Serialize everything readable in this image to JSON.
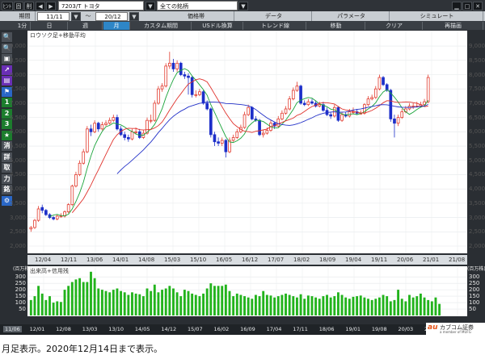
{
  "toolbar": {
    "hint_label": "ﾋﾝﾄ",
    "pin_label": "固",
    "delete_label": "削",
    "symbol_value": "7203/T トヨタ",
    "filter_value": "全ての銘柄",
    "period_label": "期間",
    "period_from": "11/11",
    "period_to": "20/12",
    "main_tabs": [
      "価格帯",
      "データ",
      "パラメータ",
      "シミュレート"
    ],
    "range_tabs": [
      "1分",
      "日",
      "週",
      "月"
    ],
    "mode_buttons": [
      "カスタム期間",
      "USドル換算",
      "トレンド線",
      "移動",
      "クリア",
      "再描画"
    ]
  },
  "sidebar": {
    "items": [
      {
        "icon": "zoom-in-icon"
      },
      {
        "icon": "zoom-out-icon"
      },
      {
        "icon": "camera-icon"
      },
      {
        "icon": "chart-line-icon"
      },
      {
        "icon": "chart-bar-icon"
      },
      {
        "icon": "flag-icon"
      },
      {
        "label": "1"
      },
      {
        "label": "2"
      },
      {
        "label": "3"
      },
      {
        "icon": "star-icon"
      },
      {
        "label": "消"
      },
      {
        "label": "詳"
      },
      {
        "label": "取"
      },
      {
        "label": "力"
      },
      {
        "label": "銘"
      },
      {
        "icon": "gear-icon"
      }
    ]
  },
  "price_panel": {
    "label": "ロウソク足+移動平均",
    "ticks": [
      "9,000",
      "8,500",
      "8,000",
      "7,500",
      "7,000",
      "6,500",
      "6,000",
      "5,500",
      "5,000",
      "4,500",
      "4,000",
      "3,500",
      "3,000",
      "2,500",
      "2,000"
    ]
  },
  "volume_panel": {
    "label": "出来高+信用残",
    "unit_top": "(百万株)",
    "unit_bottom": "(百万株)",
    "ticks": [
      "300",
      "250",
      "200",
      "150",
      "100",
      "50"
    ]
  },
  "x_axis": {
    "labels": [
      "12/04",
      "12/11",
      "13/06",
      "14/01",
      "14/08",
      "15/03",
      "15/10",
      "16/05",
      "16/12",
      "17/07",
      "18/02",
      "18/09",
      "19/04",
      "19/11",
      "20/06",
      "21/01",
      "21/08"
    ],
    "bottom_labels": [
      "11/06",
      "12/01",
      "12/08",
      "13/03",
      "13/10",
      "14/05",
      "14/12",
      "15/07",
      "16/02",
      "16/09",
      "17/04",
      "17/11",
      "18/06",
      "19/01",
      "19/08",
      "20/03",
      "20/10"
    ]
  },
  "brand": {
    "logo": "au",
    "name": "カブコム証券",
    "subtitle": "a member of MUFG"
  },
  "caption": "月足表示。2020年12月14日まで表示。",
  "colors": {
    "up_candle": "#e23b2e",
    "down_candle": "#1d2fc9",
    "ma_short": "#1aa43a",
    "ma_mid": "#e0322c",
    "ma_long": "#2230c8",
    "volume_bar": "#22b31c",
    "active_tab": "#2e86c7"
  },
  "chart_data": {
    "type": "candlestick",
    "title": "ロウソク足+移動平均",
    "xlabel": "",
    "ylabel": "",
    "ylim": [
      2000,
      9200
    ],
    "volume_ylim": [
      0,
      320
    ],
    "x": [
      "12/02",
      "12/03",
      "12/04",
      "12/05",
      "12/06",
      "12/07",
      "12/08",
      "12/09",
      "12/10",
      "12/11",
      "12/12",
      "13/01",
      "13/02",
      "13/03",
      "13/04",
      "13/05",
      "13/06",
      "13/07",
      "13/08",
      "13/09",
      "13/10",
      "13/11",
      "13/12",
      "14/01",
      "14/02",
      "14/03",
      "14/04",
      "14/05",
      "14/06",
      "14/07",
      "14/08",
      "14/09",
      "14/10",
      "14/11",
      "14/12",
      "15/01",
      "15/02",
      "15/03",
      "15/04",
      "15/05",
      "15/06",
      "15/07",
      "15/08",
      "15/09",
      "15/10",
      "15/11",
      "15/12",
      "16/01",
      "16/02",
      "16/03",
      "16/04",
      "16/05",
      "16/06",
      "16/07",
      "16/08",
      "16/09",
      "16/10",
      "16/11",
      "16/12",
      "17/01",
      "17/02",
      "17/03",
      "17/04",
      "17/05",
      "17/06",
      "17/07",
      "17/08",
      "17/09",
      "17/10",
      "17/11",
      "17/12",
      "18/01",
      "18/02",
      "18/03",
      "18/04",
      "18/05",
      "18/06",
      "18/07",
      "18/08",
      "18/09",
      "18/10",
      "18/11",
      "18/12",
      "19/01",
      "19/02",
      "19/03",
      "19/04",
      "19/05",
      "19/06",
      "19/07",
      "19/08",
      "19/09",
      "19/10",
      "19/11",
      "19/12",
      "20/01",
      "20/02",
      "20/03",
      "20/04",
      "20/05",
      "20/06",
      "20/07",
      "20/08",
      "20/09",
      "20/10",
      "20/11",
      "20/12"
    ],
    "open": [
      2600,
      2650,
      2900,
      3350,
      3250,
      3100,
      3000,
      2950,
      3050,
      3050,
      3200,
      3450,
      4100,
      4500,
      4900,
      5300,
      6100,
      6000,
      6300,
      6100,
      6250,
      6300,
      6400,
      6500,
      6100,
      5900,
      5800,
      5750,
      6000,
      6000,
      5800,
      5950,
      6400,
      6400,
      7000,
      7500,
      7600,
      8300,
      8400,
      8200,
      8400,
      8000,
      7950,
      7900,
      7300,
      7300,
      7400,
      7000,
      6800,
      5900,
      5650,
      5600,
      5700,
      5300,
      5700,
      5800,
      6000,
      6150,
      6600,
      6850,
      6450,
      6400,
      5900,
      5950,
      6050,
      6300,
      6200,
      6450,
      6650,
      6800,
      7150,
      7450,
      7600,
      7000,
      6950,
      7050,
      7000,
      6900,
      6950,
      6750,
      6600,
      6550,
      6850,
      6400,
      6600,
      6550,
      6700,
      6700,
      6650,
      6650,
      6950,
      7150,
      7200,
      7500,
      7900,
      7650,
      7450,
      6450,
      6300,
      6500,
      6700,
      6800,
      6900,
      6900,
      6900,
      6950,
      7050
    ],
    "close": [
      2650,
      2900,
      3300,
      3250,
      3100,
      3000,
      2950,
      3050,
      3050,
      3200,
      3450,
      4100,
      4500,
      4900,
      5300,
      6100,
      6000,
      6300,
      6100,
      6250,
      6300,
      6400,
      6500,
      6100,
      5900,
      5800,
      5750,
      6000,
      6000,
      5800,
      5950,
      6400,
      6400,
      7000,
      7500,
      7600,
      8300,
      8400,
      8200,
      8400,
      8000,
      7950,
      7900,
      7300,
      7300,
      7400,
      7000,
      6800,
      5900,
      5650,
      5600,
      5700,
      5300,
      5700,
      5800,
      6000,
      6150,
      6600,
      6850,
      6450,
      6400,
      5900,
      5950,
      6050,
      6300,
      6200,
      6450,
      6650,
      6800,
      7150,
      7450,
      7600,
      7000,
      6950,
      7050,
      7000,
      6900,
      6950,
      6750,
      6600,
      6550,
      6850,
      6400,
      6600,
      6550,
      6700,
      6700,
      6650,
      6650,
      6950,
      7150,
      7200,
      7500,
      7900,
      7650,
      7450,
      6450,
      6300,
      6500,
      6700,
      6800,
      6900,
      6900,
      6900,
      6950,
      7050,
      7900
    ],
    "high": [
      2700,
      2950,
      3400,
      3450,
      3300,
      3150,
      3050,
      3100,
      3150,
      3250,
      3500,
      4150,
      4600,
      5000,
      5400,
      6200,
      6250,
      6400,
      6350,
      6350,
      6400,
      6500,
      6600,
      6600,
      6200,
      6000,
      5900,
      6100,
      6150,
      6100,
      6050,
      6500,
      6600,
      7100,
      7600,
      7700,
      8400,
      8800,
      8550,
      8500,
      8450,
      8100,
      8050,
      7950,
      7450,
      7500,
      7450,
      7100,
      6850,
      6000,
      5800,
      5800,
      5750,
      5800,
      5900,
      6100,
      6250,
      6700,
      6950,
      6900,
      6550,
      6450,
      6050,
      6150,
      6400,
      6350,
      6550,
      6750,
      6900,
      7250,
      7550,
      7750,
      7650,
      7100,
      7150,
      7150,
      7100,
      7050,
      7050,
      6850,
      6700,
      6950,
      6900,
      6700,
      6700,
      6800,
      6850,
      6800,
      6750,
      7000,
      7250,
      7300,
      7600,
      8000,
      7950,
      7700,
      7500,
      6600,
      6600,
      6800,
      6900,
      7000,
      7000,
      7050,
      7050,
      7150,
      8000
    ],
    "low": [
      2500,
      2600,
      2850,
      3150,
      3050,
      2950,
      2900,
      2900,
      3000,
      3000,
      3150,
      3400,
      4050,
      4450,
      4850,
      5250,
      5850,
      5950,
      6000,
      6050,
      6200,
      6250,
      6350,
      6050,
      5850,
      5700,
      5650,
      5700,
      5900,
      5750,
      5750,
      5900,
      6300,
      6350,
      6950,
      7400,
      7550,
      8200,
      8100,
      8100,
      7950,
      7850,
      7300,
      7200,
      7200,
      7250,
      6950,
      6750,
      5800,
      5500,
      5500,
      5500,
      5100,
      5250,
      5650,
      5750,
      5950,
      6100,
      6550,
      6400,
      6350,
      5850,
      5800,
      5900,
      6000,
      6100,
      6150,
      6400,
      6600,
      6750,
      7100,
      7400,
      6950,
      6900,
      6900,
      6950,
      6850,
      6850,
      6700,
      6550,
      6450,
      6500,
      6350,
      6350,
      6500,
      6500,
      6600,
      6600,
      6600,
      6600,
      6900,
      7100,
      7150,
      7450,
      7600,
      7400,
      6350,
      5800,
      6200,
      6450,
      6650,
      6750,
      6800,
      6850,
      6850,
      6900,
      7000
    ],
    "volume": [
      120,
      150,
      230,
      170,
      120,
      150,
      100,
      110,
      105,
      200,
      230,
      260,
      280,
      290,
      260,
      260,
      340,
      290,
      210,
      200,
      190,
      180,
      200,
      210,
      190,
      180,
      160,
      180,
      170,
      165,
      150,
      210,
      190,
      240,
      180,
      200,
      210,
      230,
      210,
      180,
      150,
      200,
      190,
      170,
      160,
      150,
      170,
      210,
      250,
      230,
      230,
      230,
      240,
      190,
      150,
      170,
      160,
      150,
      140,
      130,
      160,
      150,
      190,
      160,
      155,
      140,
      150,
      160,
      170,
      160,
      150,
      140,
      165,
      130,
      155,
      150,
      140,
      130,
      150,
      160,
      140,
      150,
      180,
      160,
      140,
      130,
      145,
      150,
      155,
      140,
      130,
      120,
      130,
      140,
      160,
      150,
      110,
      120,
      200,
      130,
      110,
      160,
      140,
      150,
      170,
      140,
      120,
      110,
      140,
      90
    ]
  }
}
